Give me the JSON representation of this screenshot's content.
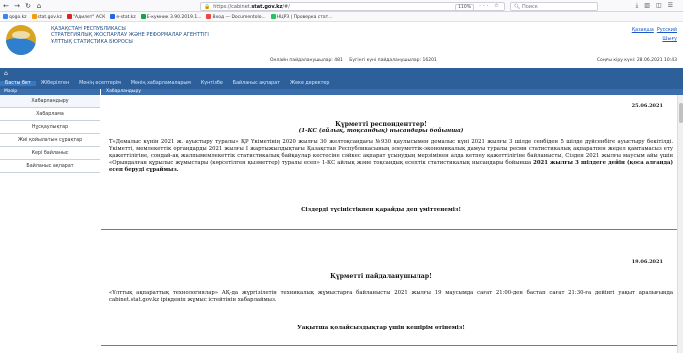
{
  "browser": {
    "url_prefix": "https://cabinet.",
    "url_domain": "stat.gov.kz",
    "url_suffix": "/#/",
    "zoom": "110%",
    "search_placeholder": "Поиск",
    "bookmarks": [
      {
        "label": "qogo.kz",
        "color": "#3b82f6"
      },
      {
        "label": "stat.gov.kz",
        "color": "#f59e0b"
      },
      {
        "label": "\"Адилет\" АСК",
        "color": "#dc2626"
      },
      {
        "label": "e-stat.kz",
        "color": "#2563eb"
      },
      {
        "label": "E-кумник 3.90.2019.1...",
        "color": "#16a34a"
      },
      {
        "label": "Вход — Documentolo...",
        "color": "#ef4444"
      },
      {
        "label": "НЦРЗ | Проверка стат...",
        "color": "#22c55e"
      }
    ]
  },
  "header": {
    "org_lines": [
      "Қазақстан Республикасы",
      "Стратегиялық жоспарлау және реформалар агенттігі",
      "Ұлттық статистика бюросы"
    ],
    "online_label": "Онлайн пайдаланушылар: 481",
    "today_label": "Бүгінгі күні пайдаланушылар: 16201",
    "link_cabinet": "Қазақшa",
    "link_russian": "Русский",
    "link_exit": "Шығу",
    "service_date": "Соңғы кіру күні: 28.06.2021 10:43"
  },
  "nav": {
    "items": [
      "Басты бет",
      "Жіберілген",
      "Менің есептерім",
      "Менің хабарламаларым",
      "Күнтізбе",
      "Байланыс ақпарат",
      "Жеке деректер"
    ],
    "active_index": 0
  },
  "sidebar": {
    "title": "Мазір",
    "items": [
      "Хабарландыру",
      "Хабарлама",
      "Нұсқаулықтар",
      "Жиі қойылатын сұрақтар",
      "Кері байланыс",
      "Байланыс ақпарат"
    ]
  },
  "main": {
    "title": "Хабарландыру",
    "notice1": {
      "date": "25.06.2021",
      "title": "Құрметті респонденттер!",
      "subtitle": "(1-КС (айлық, тоқсандық) нысандары бойынша)",
      "paragraph": "Т«Демалыс күнін 2021 ж. ауыстыру туралы» ҚР Үкіметінің 2020 жылғы 30 желтоқсандағы №930 қаулысымен демалыс күні 2021 жылғы 3 шілде сенбіден 5 шілде дүйсенбіге ауыстыру бекітілді. Үкіметті, мемлекеттік органдарды 2021 жылғы I жартыжылдықтағы Қазақстан Республикасының әлеуметтік-экономикалық дамуы туралы ресми статистикалық ақпаратпен жедел қамтамасыз ету қажеттілігіне, сондай-ақ жалпымемлекеттік статистикалық байқаулар кестесіне сәйкес ақпарат ұсынудың мерзімінен алда кетпеу қажеттілігіне байланысты, Сізден 2021 жылғы маусым айы үшін «Орындалған құрылыс жұмыстары (көрсетілген қызметтер) туралы есеп» 1-КС айлық және тоқсандық есептік статистикалық нысандары бойынша",
      "bold_part": "2021 жылғы 3 шілдеге дейін (қоса алғанда) есеп беруді сұраймыз.",
      "closing": "Сіздерді түсіністікпен қарайды деп үміттенеміз!"
    },
    "notice2": {
      "date": "19.06.2021",
      "title": "Құрметті пайдаланушылар!",
      "paragraph": "«Ұлттық ақпараттық технологиялар» АҚ-да жүргізілетін техникалық жұмыстарға байланысты 2021 жылғы 19 маусымда сағат 21:00-ден бастап сағат 21:30-ға дейінгі уақыт аралығында cabinet.stat.gov.kz іріқденіп жұмыс істейтінін хабарлаймыз.",
      "closing": "Уақытша қолайсыздықтар үшін кешірім өтінеміз!"
    }
  }
}
